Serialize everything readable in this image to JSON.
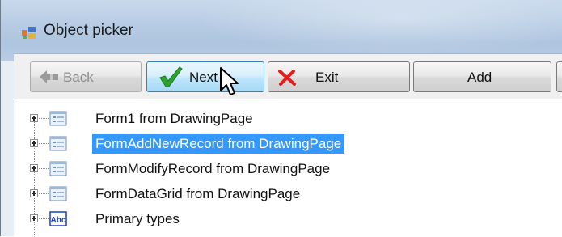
{
  "window": {
    "title": "Object picker"
  },
  "toolbar": {
    "back_label": "Back",
    "next_label": "Next",
    "exit_label": "Exit",
    "add_label": "Add"
  },
  "tree": {
    "items": [
      {
        "label": "Form1 from DrawingPage",
        "icon": "form-icon",
        "selected": false
      },
      {
        "label": "FormAddNewRecord from DrawingPage",
        "icon": "form-icon",
        "selected": true
      },
      {
        "label": "FormModifyRecord from DrawingPage",
        "icon": "form-icon",
        "selected": false
      },
      {
        "label": "FormDataGrid from DrawingPage",
        "icon": "form-icon",
        "selected": false
      },
      {
        "label": "Primary types",
        "icon": "abc-type-icon",
        "selected": false
      }
    ]
  },
  "colors": {
    "selection": "#3399ff",
    "next_check": "#2fa32f",
    "exit_x": "#e02020"
  }
}
